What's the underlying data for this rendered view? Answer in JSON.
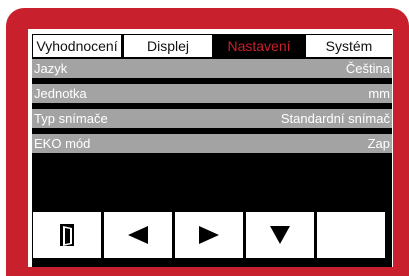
{
  "tabs": [
    {
      "label": "Vyhodnocení",
      "active": false
    },
    {
      "label": "Displej",
      "active": false
    },
    {
      "label": "Nastavení",
      "active": true
    },
    {
      "label": "Systém",
      "active": false
    }
  ],
  "settings": [
    {
      "label": "Jazyk",
      "value": "Čeština"
    },
    {
      "label": "Jednotka",
      "value": "mm"
    },
    {
      "label": "Typ snímače",
      "value": "Standardní snímač"
    },
    {
      "label": "EKO mód",
      "value": "Zap"
    }
  ],
  "toolbar": {
    "buttons": [
      {
        "icon": "exit-door-icon"
      },
      {
        "icon": "arrow-left-icon"
      },
      {
        "icon": "arrow-right-icon"
      },
      {
        "icon": "arrow-down-icon"
      },
      {
        "icon": "empty"
      }
    ]
  },
  "colors": {
    "bezel": "#c8202c",
    "active_tab_text": "#c8202c",
    "row_background": "#a3a3a3",
    "screen_background": "#000000"
  }
}
